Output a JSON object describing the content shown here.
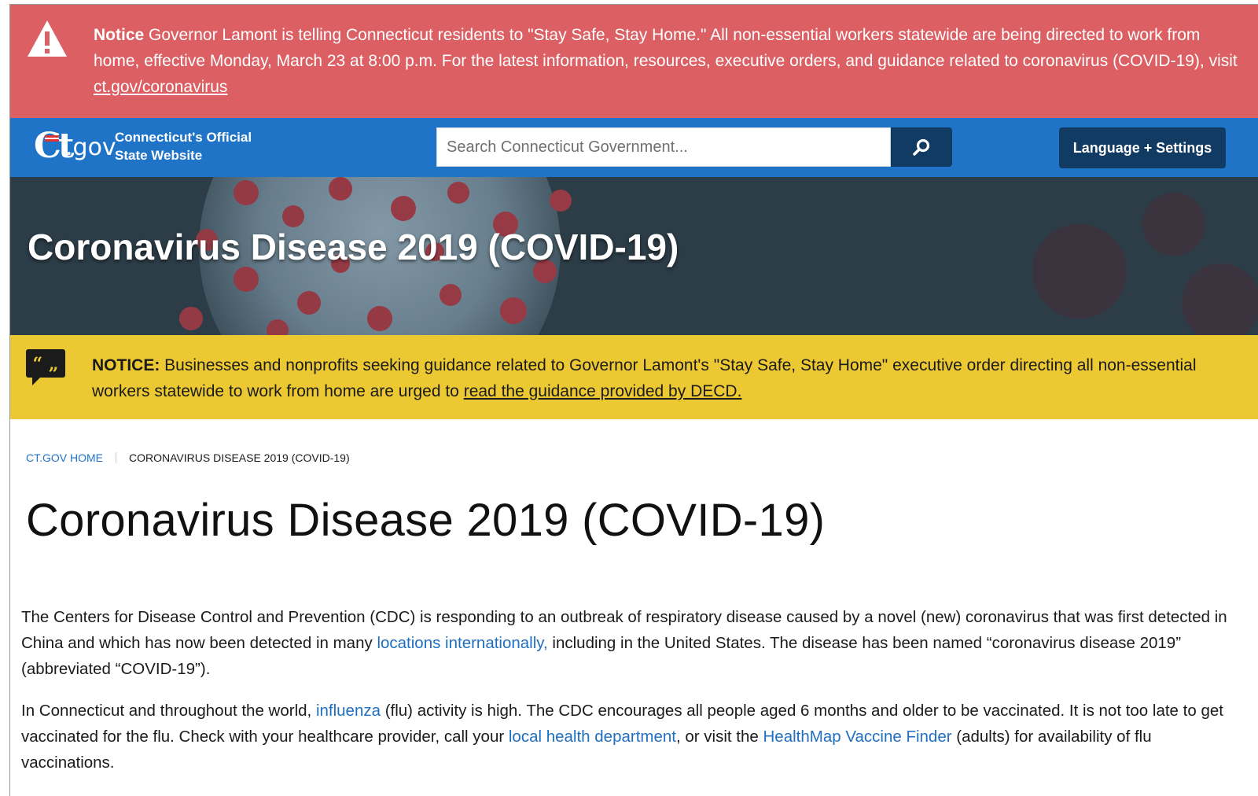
{
  "alert": {
    "label": "Notice",
    "text_before_link": " Governor Lamont is telling Connecticut residents to \"Stay Safe, Stay Home.\" All non-essential workers statewide are being directed to work from home, effective Monday, March 23 at 8:00 p.m. For the latest information, resources, executive orders, and guidance related to coronavirus (COVID-19), visit ",
    "link_text": "ct.gov/coronavirus",
    "icon": "warning-triangle-icon"
  },
  "header": {
    "logo_ct": "Ct",
    "logo_gov": ".gov",
    "tagline_line1": "Connecticut's Official",
    "tagline_line2": "State Website",
    "search_placeholder": "Search Connecticut Government...",
    "search_icon": "search-icon",
    "language_button": "Language + Settings",
    "colors": {
      "header_bg": "#1f74c8",
      "button_bg": "#123b63"
    }
  },
  "banner": {
    "title": "Coronavirus Disease 2019 (COVID-19)"
  },
  "notice": {
    "label": "NOTICE:",
    "text_before_link": " Businesses and nonprofits seeking guidance related to Governor Lamont's \"Stay Safe, Stay Home\" executive order directing all non-essential workers statewide to work from home are urged to ",
    "link_text": "read the guidance provided by DECD.",
    "icon": "quote-bubble-icon",
    "bg_color": "#ecc832"
  },
  "breadcrumb": {
    "home": "CT.GOV HOME",
    "current": "CORONAVIRUS DISEASE 2019 (COVID-19)"
  },
  "main": {
    "title": "Coronavirus Disease 2019 (COVID-19)",
    "p1": {
      "t1": "The Centers for Disease Control and Prevention (CDC) is responding to an outbreak of respiratory disease caused by a novel (new) coronavirus that was first detected in China and which has now been detected in many ",
      "link1": "locations internationally,",
      "t2": " including in the United States. The disease has been named “coronavirus disease 2019” (abbreviated “COVID-19”)."
    },
    "p2": {
      "t1": "In Connecticut and throughout the world, ",
      "link1": "influenza",
      "t2": " (flu) activity is high. The CDC encourages all people aged 6 months and older to be vaccinated. It is not too late to get vaccinated for the flu. Check with your healthcare provider, call your ",
      "link2": "local health department",
      "t3": ", or visit the ",
      "link3": "HealthMap Vaccine Finder",
      "t4": " (adults) for availability of flu vaccinations."
    }
  },
  "colors": {
    "alert_bg": "#dc5f63",
    "link": "#1f6fc0"
  }
}
